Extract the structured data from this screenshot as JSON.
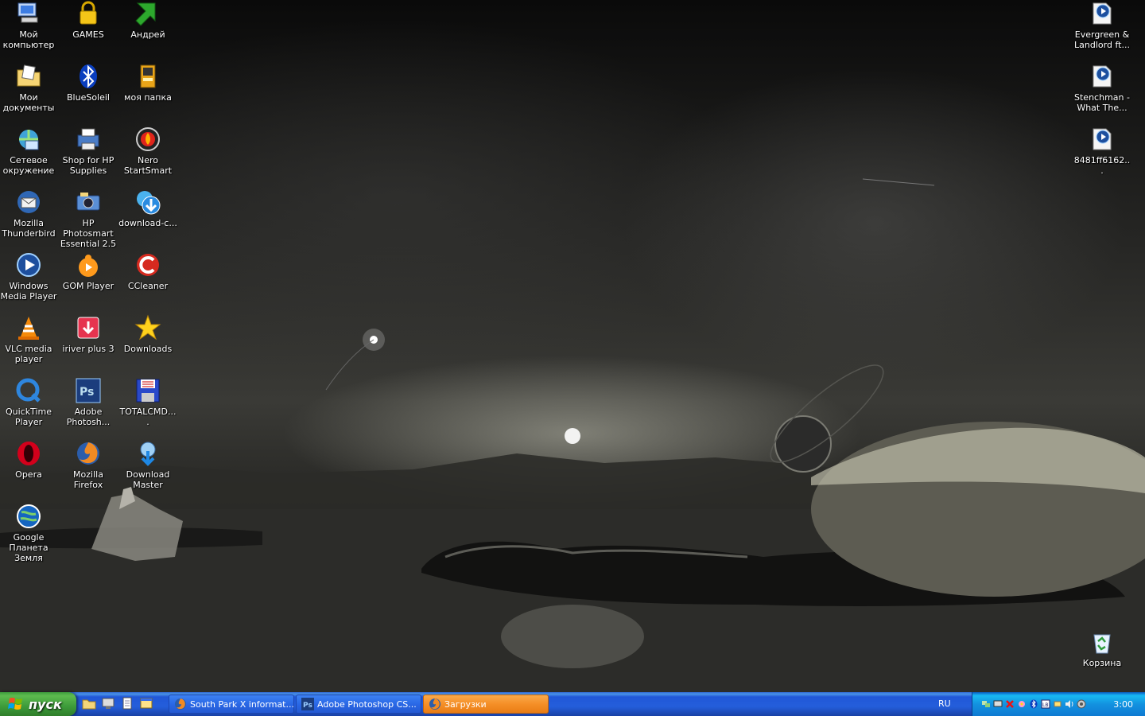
{
  "desktop": {
    "left_icons": [
      {
        "id": "my-computer",
        "label": "Мой компьютер",
        "icon": "computer-icon"
      },
      {
        "id": "games",
        "label": "GAMES",
        "icon": "lock-folder-icon"
      },
      {
        "id": "andrey",
        "label": "Андрей",
        "icon": "green-arrow-icon"
      },
      {
        "id": "my-documents",
        "label": "Мои документы",
        "icon": "documents-folder-icon"
      },
      {
        "id": "bluesoleil",
        "label": "BlueSoleil",
        "icon": "bluetooth-icon"
      },
      {
        "id": "my-folder",
        "label": "моя папка",
        "icon": "folder-icon"
      },
      {
        "id": "network",
        "label": "Сетевое окружение",
        "icon": "network-icon"
      },
      {
        "id": "shop-hp",
        "label": "Shop for HP Supplies",
        "icon": "printer-icon"
      },
      {
        "id": "nero",
        "label": "Nero StartSmart",
        "icon": "nero-icon"
      },
      {
        "id": "thunderbird",
        "label": "Mozilla Thunderbird",
        "icon": "thunderbird-icon"
      },
      {
        "id": "hp-photosmart",
        "label": "HP Photosmart Essential 2.5",
        "icon": "camera-icon"
      },
      {
        "id": "download-c",
        "label": "download-c...",
        "icon": "download-icon"
      },
      {
        "id": "wmp",
        "label": "Windows Media Player",
        "icon": "media-player-icon"
      },
      {
        "id": "gom",
        "label": "GOM Player",
        "icon": "gom-icon"
      },
      {
        "id": "ccleaner",
        "label": "CCleaner",
        "icon": "ccleaner-icon"
      },
      {
        "id": "vlc",
        "label": "VLC media player",
        "icon": "vlc-cone-icon"
      },
      {
        "id": "iriver",
        "label": "iriver plus 3",
        "icon": "iriver-icon"
      },
      {
        "id": "downloads",
        "label": "Downloads",
        "icon": "star-icon"
      },
      {
        "id": "quicktime",
        "label": "QuickTime Player",
        "icon": "quicktime-icon"
      },
      {
        "id": "photoshop",
        "label": "Adobe Photosh...",
        "icon": "photoshop-icon"
      },
      {
        "id": "totalcmd",
        "label": "TOTALCMD....",
        "icon": "floppy-icon"
      },
      {
        "id": "opera",
        "label": "Opera",
        "icon": "opera-icon"
      },
      {
        "id": "firefox",
        "label": "Mozilla Firefox",
        "icon": "firefox-icon"
      },
      {
        "id": "download-master",
        "label": "Download Master",
        "icon": "download-master-icon"
      },
      {
        "id": "google-earth",
        "label": "Google Планета Земля",
        "icon": "globe-icon"
      }
    ],
    "right_icons": [
      {
        "id": "evergreen",
        "label": "Evergreen & Landlord ft...",
        "icon": "media-file-icon"
      },
      {
        "id": "stenchman",
        "label": "Stenchman - What The...",
        "icon": "media-file-icon"
      },
      {
        "id": "8481ff",
        "label": "8481ff6162...",
        "icon": "media-file-icon"
      },
      {
        "id": "recycle-bin",
        "label": "Корзина",
        "icon": "recycle-bin-icon"
      }
    ]
  },
  "taskbar": {
    "start_label": "пуск",
    "quick_launch": [
      "folder-icon",
      "desktop-icon",
      "notepad-icon",
      "window-icon"
    ],
    "tasks": [
      {
        "label": "South Park X informat...",
        "icon": "firefox-icon",
        "active": false
      },
      {
        "label": "Adobe Photoshop CS...",
        "icon": "photoshop-icon",
        "active": false
      },
      {
        "label": "Загрузки",
        "icon": "firefox-icon",
        "active": true
      }
    ],
    "language": "RU",
    "tray_icons": [
      "network-tray-icon",
      "display-tray-icon",
      "antivirus-tray-icon",
      "flower-tray-icon",
      "bluetooth-tray-icon",
      "lb-tray-icon",
      "device-tray-icon",
      "volume-tray-icon",
      "shield-tray-icon"
    ],
    "clock": "3:00"
  },
  "colors": {
    "taskbar": "#245edb",
    "start": "#3d9b3a",
    "active_task": "#f58f27",
    "tray": "#1392e0"
  }
}
